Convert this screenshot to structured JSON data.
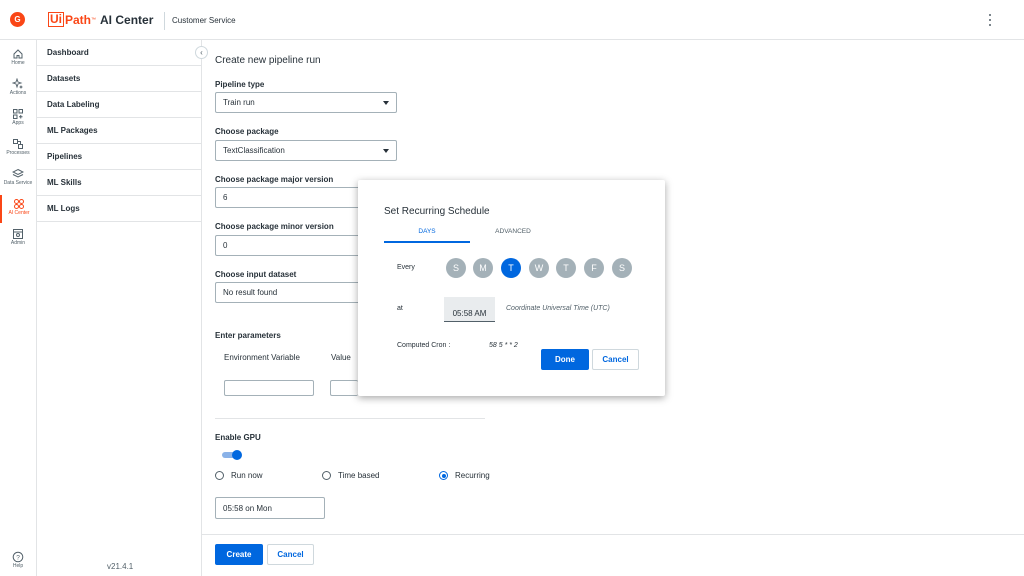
{
  "header": {
    "avatar_initial": "G",
    "logo_ui": "Ui",
    "logo_path": "Path",
    "logo_tm": "™",
    "product": "AI Center",
    "tenant": "Customer Service"
  },
  "rail": {
    "items": [
      {
        "label": "Home",
        "icon": "home-icon"
      },
      {
        "label": "Actions",
        "icon": "sparkle-icon"
      },
      {
        "label": "Apps",
        "icon": "apps-icon"
      },
      {
        "label": "Processes",
        "icon": "processes-icon"
      },
      {
        "label": "Data Service",
        "icon": "layers-icon"
      },
      {
        "label": "AI Center",
        "icon": "ai-center-icon"
      },
      {
        "label": "Admin",
        "icon": "admin-icon"
      }
    ],
    "help_label": "Help",
    "accent": "#fa4616"
  },
  "subnav": {
    "items": [
      "Dashboard",
      "Datasets",
      "Data Labeling",
      "ML Packages",
      "Pipelines",
      "ML Skills",
      "ML Logs"
    ],
    "collapse_glyph": "‹",
    "version": "v21.4.1"
  },
  "form": {
    "title": "Create new pipeline run",
    "pipeline_type": {
      "label": "Pipeline type",
      "value": "Train run"
    },
    "package": {
      "label": "Choose package",
      "value": "TextClassification"
    },
    "major_version": {
      "label": "Choose package major version",
      "value": "6"
    },
    "minor_version": {
      "label": "Choose package minor version",
      "value": "0"
    },
    "input_dataset": {
      "label": "Choose input dataset",
      "value": "No result found"
    },
    "parameters": {
      "label": "Enter parameters",
      "col_env": "Environment Variable",
      "col_value": "Value"
    },
    "gpu": {
      "label": "Enable GPU",
      "enabled": true
    },
    "run_options": [
      {
        "label": "Run now",
        "selected": false
      },
      {
        "label": "Time based",
        "selected": false
      },
      {
        "label": "Recurring",
        "selected": true
      }
    ],
    "schedule_value": "05:58 on Mon",
    "create_label": "Create",
    "cancel_label": "Cancel"
  },
  "dialog": {
    "title": "Set Recurring Schedule",
    "tabs": [
      {
        "label": "DAYS",
        "active": true
      },
      {
        "label": "ADVANCED",
        "active": false
      }
    ],
    "every_label": "Every",
    "days": [
      {
        "letter": "S",
        "selected": false
      },
      {
        "letter": "M",
        "selected": false
      },
      {
        "letter": "T",
        "selected": true
      },
      {
        "letter": "W",
        "selected": false
      },
      {
        "letter": "T",
        "selected": false
      },
      {
        "letter": "F",
        "selected": false
      },
      {
        "letter": "S",
        "selected": false
      }
    ],
    "at_label": "at",
    "time": "05:58 AM",
    "timezone": "Coordinate Universal Time (UTC)",
    "cron_label": "Computed Cron :",
    "cron_value": "58 5 * * 2",
    "done_label": "Done",
    "cancel_label": "Cancel"
  },
  "colors": {
    "primary": "#0067df",
    "brand": "#fa4616",
    "day_inactive": "#a4b1b8"
  }
}
